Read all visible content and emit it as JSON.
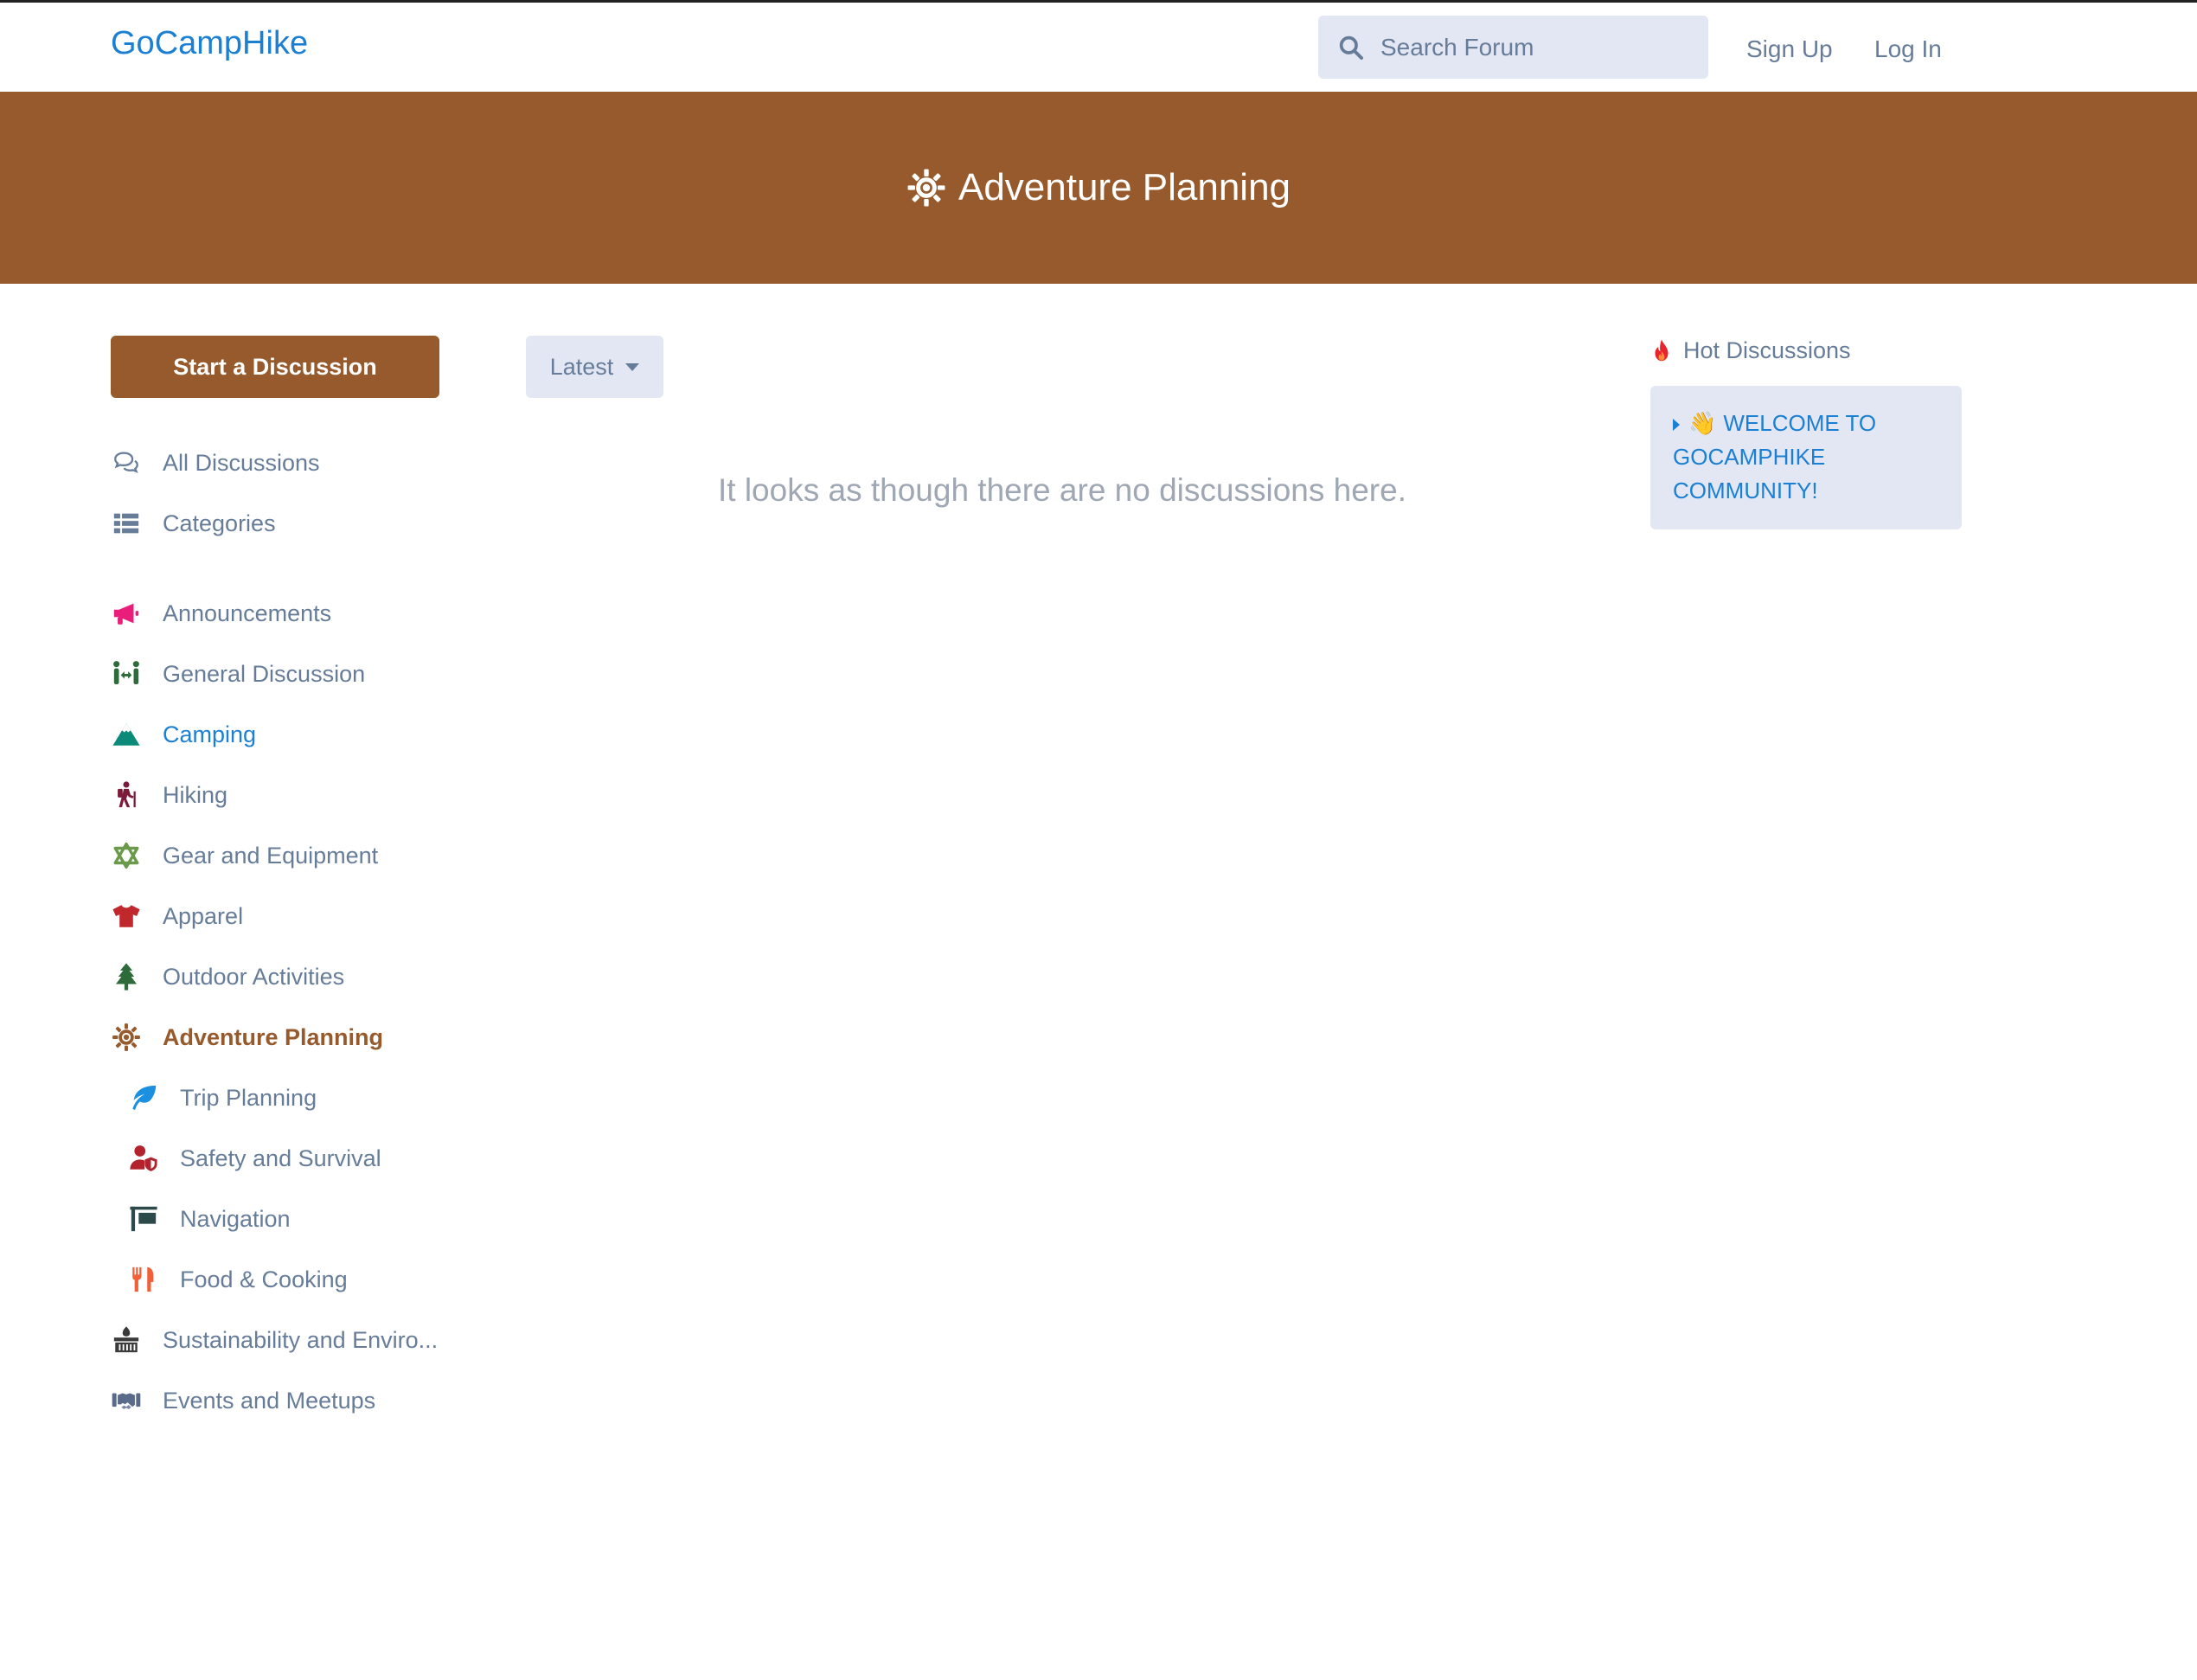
{
  "header": {
    "brand": "GoCampHike",
    "search_placeholder": "Search Forum",
    "sign_up": "Sign Up",
    "log_in": "Log In"
  },
  "hero": {
    "title": "Adventure Planning",
    "icon": "gear-icon"
  },
  "sidebar": {
    "start_button": "Start a Discussion",
    "primary": [
      {
        "label": "All Discussions",
        "icon": "comments-icon"
      },
      {
        "label": "Categories",
        "icon": "list-icon"
      }
    ],
    "categories": [
      {
        "label": "Announcements",
        "icon": "megaphone-icon",
        "color": "#e91e7a"
      },
      {
        "label": "General Discussion",
        "icon": "people-arrows-icon",
        "color": "#2e6b3a"
      },
      {
        "label": "Camping",
        "icon": "mountain-icon",
        "color": "#0b8a7a"
      },
      {
        "label": "Hiking",
        "icon": "hiker-icon",
        "color": "#7a1b3a"
      },
      {
        "label": "Gear and Equipment",
        "icon": "star-of-david-icon",
        "color": "#6a9a4a"
      },
      {
        "label": "Apparel",
        "icon": "shirt-icon",
        "color": "#c0282d"
      },
      {
        "label": "Outdoor Activities",
        "icon": "tree-icon",
        "color": "#2e6b3a"
      },
      {
        "label": "Adventure Planning",
        "icon": "gear-icon",
        "color": "#965a2c"
      },
      {
        "label": "Trip Planning",
        "icon": "leaf-icon",
        "color": "#1b8fe0"
      },
      {
        "label": "Safety and Survival",
        "icon": "user-shield-icon",
        "color": "#b3232e"
      },
      {
        "label": "Navigation",
        "icon": "signpost-icon",
        "color": "#2d4a4a"
      },
      {
        "label": "Food & Cooking",
        "icon": "utensils-icon",
        "color": "#f2603a"
      },
      {
        "label": "Sustainability and Enviro...",
        "icon": "dumpster-fire-icon",
        "color": "#3a3a3a"
      },
      {
        "label": "Events and Meetups",
        "icon": "handshake-icon",
        "color": "#5a6a8a"
      }
    ]
  },
  "main": {
    "sort_label": "Latest",
    "empty_message": "It looks as though there are no discussions here."
  },
  "hot": {
    "title": "Hot Discussions",
    "icon": "fire-icon",
    "items": [
      {
        "emoji": "👋",
        "text": "Welcome to GoCampHike Community!"
      }
    ]
  },
  "colors": {
    "brand": "#1b7fd3",
    "accent": "#965a2c",
    "muted_bg": "#e3e7f4",
    "text": "#667c99"
  }
}
